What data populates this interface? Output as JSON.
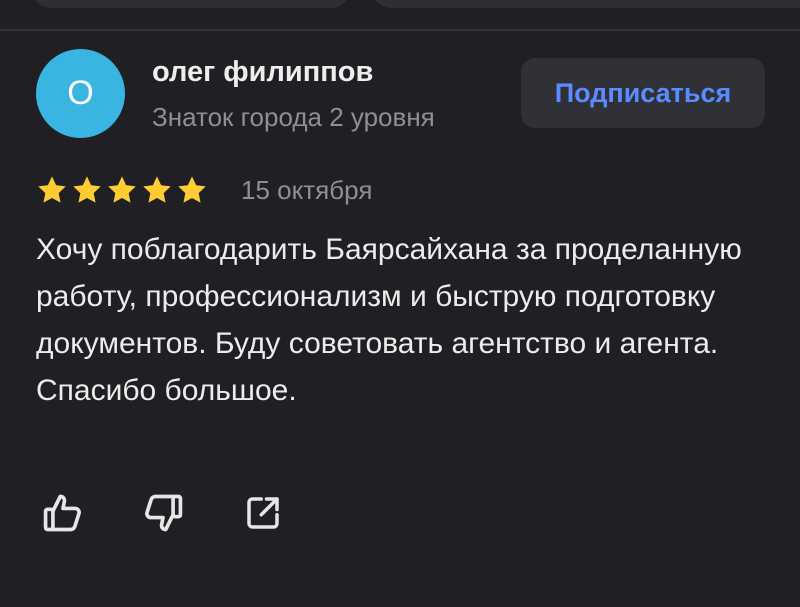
{
  "author": {
    "initial": "О",
    "name": "олег филиппов",
    "level": "Знаток города 2 уровня",
    "avatar_color": "#3ab5e2"
  },
  "subscribe": {
    "label": "Подписаться",
    "text_color": "#5b8cff"
  },
  "review": {
    "rating": 5,
    "rating_max": 5,
    "star_color": "#ffcc33",
    "date": "15 октября",
    "text": "Хочу поблагодарить Баярсайхана за проделанную работу, профессионализм и быструю подготовку документов. Буду советовать агентство и агента. Спасибо большое."
  },
  "actions": [
    {
      "name": "like",
      "icon": "thumbs-up-icon"
    },
    {
      "name": "dislike",
      "icon": "thumbs-down-icon"
    },
    {
      "name": "share",
      "icon": "share-icon"
    }
  ]
}
